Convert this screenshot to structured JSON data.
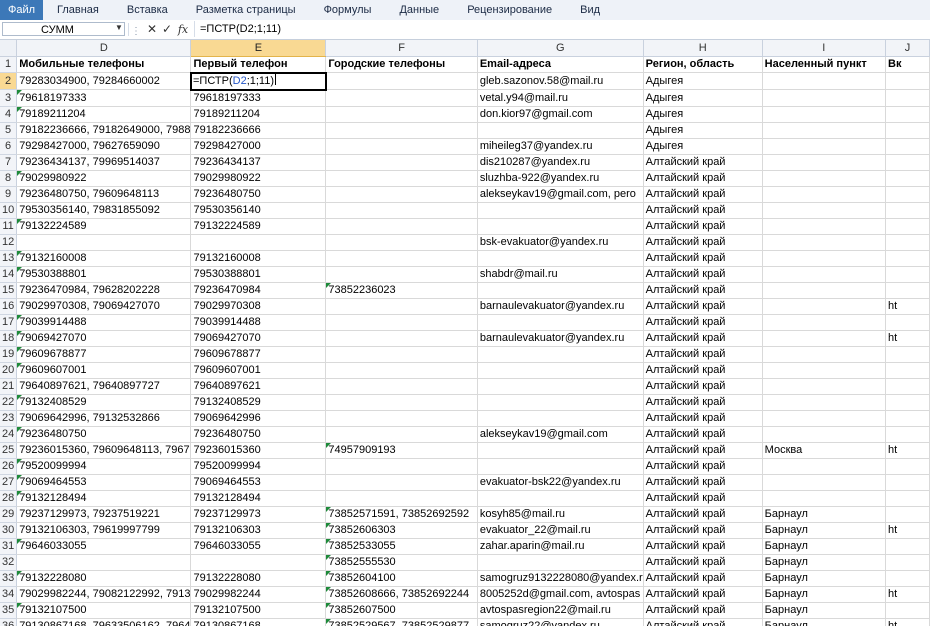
{
  "ribbon": {
    "tabs": [
      "Файл",
      "Главная",
      "Вставка",
      "Разметка страницы",
      "Формулы",
      "Данные",
      "Рецензирование",
      "Вид"
    ]
  },
  "formula_bar": {
    "name_box": "СУММ",
    "fx_label": "fx",
    "formula": "=ПСТР(D2;1;11)"
  },
  "active_cell": {
    "prefix": "=ПСТР(",
    "ref": "D2",
    "suffix": ";1;11)"
  },
  "columns": [
    "D",
    "E",
    "F",
    "G",
    "H",
    "I",
    "J"
  ],
  "rows": [
    {
      "n": "1",
      "d": "Мобильные телефоны",
      "e": "Первый телефон",
      "f": "Городские телефоны",
      "g": "Email-адреса",
      "h": "Регион, область",
      "i": "Населенный пункт",
      "j": "Вк"
    },
    {
      "n": "2",
      "d": "79283034900, 79284660002",
      "e": "",
      "f": "",
      "g": "gleb.sazonov.58@mail.ru",
      "h": "Адыгея",
      "i": "",
      "j": ""
    },
    {
      "n": "3",
      "d": "79618197333",
      "e": "79618197333",
      "f": "",
      "g": "vetal.y94@mail.ru",
      "h": "Адыгея",
      "i": "",
      "j": ""
    },
    {
      "n": "4",
      "d": "79189211204",
      "e": "79189211204",
      "f": "",
      "g": "don.kior97@gmail.com",
      "h": "Адыгея",
      "i": "",
      "j": ""
    },
    {
      "n": "5",
      "d": "79182236666, 79182649000, 7988",
      "e": "79182236666",
      "f": "",
      "g": "",
      "h": "Адыгея",
      "i": "",
      "j": ""
    },
    {
      "n": "6",
      "d": "79298427000, 79627659090",
      "e": "79298427000",
      "f": "",
      "g": "miheileg37@yandex.ru",
      "h": "Адыгея",
      "i": "",
      "j": ""
    },
    {
      "n": "7",
      "d": "79236434137, 79969514037",
      "e": "79236434137",
      "f": "",
      "g": "dis210287@yandex.ru",
      "h": "Алтайский край",
      "i": "",
      "j": ""
    },
    {
      "n": "8",
      "d": "79029980922",
      "e": "79029980922",
      "f": "",
      "g": "sluzhba-922@yandex.ru",
      "h": "Алтайский край",
      "i": "",
      "j": ""
    },
    {
      "n": "9",
      "d": "79236480750, 79609648113",
      "e": "79236480750",
      "f": "",
      "g": "alekseykav19@gmail.com, pero",
      "h": "Алтайский край",
      "i": "",
      "j": ""
    },
    {
      "n": "10",
      "d": "79530356140, 79831855092",
      "e": "79530356140",
      "f": "",
      "g": "",
      "h": "Алтайский край",
      "i": "",
      "j": ""
    },
    {
      "n": "11",
      "d": "79132224589",
      "e": "79132224589",
      "f": "",
      "g": "",
      "h": "Алтайский край",
      "i": "",
      "j": ""
    },
    {
      "n": "12",
      "d": "",
      "e": "",
      "f": "",
      "g": "bsk-evakuator@yandex.ru",
      "h": "Алтайский край",
      "i": "",
      "j": ""
    },
    {
      "n": "13",
      "d": "79132160008",
      "e": "79132160008",
      "f": "",
      "g": "",
      "h": "Алтайский край",
      "i": "",
      "j": ""
    },
    {
      "n": "14",
      "d": "79530388801",
      "e": "79530388801",
      "f": "",
      "g": "shabdr@mail.ru",
      "h": "Алтайский край",
      "i": "",
      "j": ""
    },
    {
      "n": "15",
      "d": "79236470984, 79628202228",
      "e": "79236470984",
      "f": "73852236023",
      "g": "",
      "h": "Алтайский край",
      "i": "",
      "j": ""
    },
    {
      "n": "16",
      "d": "79029970308, 79069427070",
      "e": "79029970308",
      "f": "",
      "g": "barnaulevakuator@yandex.ru",
      "h": "Алтайский край",
      "i": "",
      "j": "ht"
    },
    {
      "n": "17",
      "d": "79039914488",
      "e": "79039914488",
      "f": "",
      "g": "",
      "h": "Алтайский край",
      "i": "",
      "j": ""
    },
    {
      "n": "18",
      "d": "79069427070",
      "e": "79069427070",
      "f": "",
      "g": "barnaulevakuator@yandex.ru",
      "h": "Алтайский край",
      "i": "",
      "j": "ht"
    },
    {
      "n": "19",
      "d": "79609678877",
      "e": "79609678877",
      "f": "",
      "g": "",
      "h": "Алтайский край",
      "i": "",
      "j": ""
    },
    {
      "n": "20",
      "d": "79609607001",
      "e": "79609607001",
      "f": "",
      "g": "",
      "h": "Алтайский край",
      "i": "",
      "j": ""
    },
    {
      "n": "21",
      "d": "79640897621, 79640897727",
      "e": "79640897621",
      "f": "",
      "g": "",
      "h": "Алтайский край",
      "i": "",
      "j": ""
    },
    {
      "n": "22",
      "d": "79132408529",
      "e": "79132408529",
      "f": "",
      "g": "",
      "h": "Алтайский край",
      "i": "",
      "j": ""
    },
    {
      "n": "23",
      "d": "79069642996, 79132532866",
      "e": "79069642996",
      "f": "",
      "g": "",
      "h": "Алтайский край",
      "i": "",
      "j": ""
    },
    {
      "n": "24",
      "d": "79236480750",
      "e": "79236480750",
      "f": "",
      "g": "alekseykav19@gmail.com",
      "h": "Алтайский край",
      "i": "",
      "j": ""
    },
    {
      "n": "25",
      "d": "79236015360, 79609648113, 7967",
      "e": "79236015360",
      "f": "74957909193",
      "g": "",
      "h": "Алтайский край",
      "i": "Москва",
      "j": "ht"
    },
    {
      "n": "26",
      "d": "79520099994",
      "e": "79520099994",
      "f": "",
      "g": "",
      "h": "Алтайский край",
      "i": "",
      "j": ""
    },
    {
      "n": "27",
      "d": "79069464553",
      "e": "79069464553",
      "f": "",
      "g": "evakuator-bsk22@yandex.ru",
      "h": "Алтайский край",
      "i": "",
      "j": ""
    },
    {
      "n": "28",
      "d": "79132128494",
      "e": "79132128494",
      "f": "",
      "g": "",
      "h": "Алтайский край",
      "i": "",
      "j": ""
    },
    {
      "n": "29",
      "d": "79237129973, 79237519221",
      "e": "79237129973",
      "f": "73852571591, 73852692592",
      "g": "kosyh85@mail.ru",
      "h": "Алтайский край",
      "i": "Барнаул",
      "j": ""
    },
    {
      "n": "30",
      "d": "79132106303, 79619997799",
      "e": "79132106303",
      "f": "73852606303",
      "g": "evakuator_22@mail.ru",
      "h": "Алтайский край",
      "i": "Барнаул",
      "j": "ht"
    },
    {
      "n": "31",
      "d": "79646033055",
      "e": "79646033055",
      "f": "73852533055",
      "g": "zahar.aparin@mail.ru",
      "h": "Алтайский край",
      "i": "Барнаул",
      "j": ""
    },
    {
      "n": "32",
      "d": "",
      "e": "",
      "f": "73852555530",
      "g": "",
      "h": "Алтайский край",
      "i": "Барнаул",
      "j": ""
    },
    {
      "n": "33",
      "d": "79132228080",
      "e": "79132228080",
      "f": "73852604100",
      "g": "samogruz9132228080@yandex.r",
      "h": "Алтайский край",
      "i": "Барнаул",
      "j": ""
    },
    {
      "n": "34",
      "d": "79029982244, 79082122992, 7913",
      "e": "79029982244",
      "f": "73852608666, 73852692244",
      "g": "8005252d@gmail.com, avtospas",
      "h": "Алтайский край",
      "i": "Барнаул",
      "j": "ht"
    },
    {
      "n": "35",
      "d": "79132107500",
      "e": "79132107500",
      "f": "73852607500",
      "g": "avtospasregion22@mail.ru",
      "h": "Алтайский край",
      "i": "Барнаул",
      "j": ""
    },
    {
      "n": "36",
      "d": "79130867168, 79633506162, 7964",
      "e": "79130867168",
      "f": "73852529567, 73852529877",
      "g": "samogruz22@yandex.ru",
      "h": "Алтайский край",
      "i": "Барнаул",
      "j": "ht"
    }
  ]
}
